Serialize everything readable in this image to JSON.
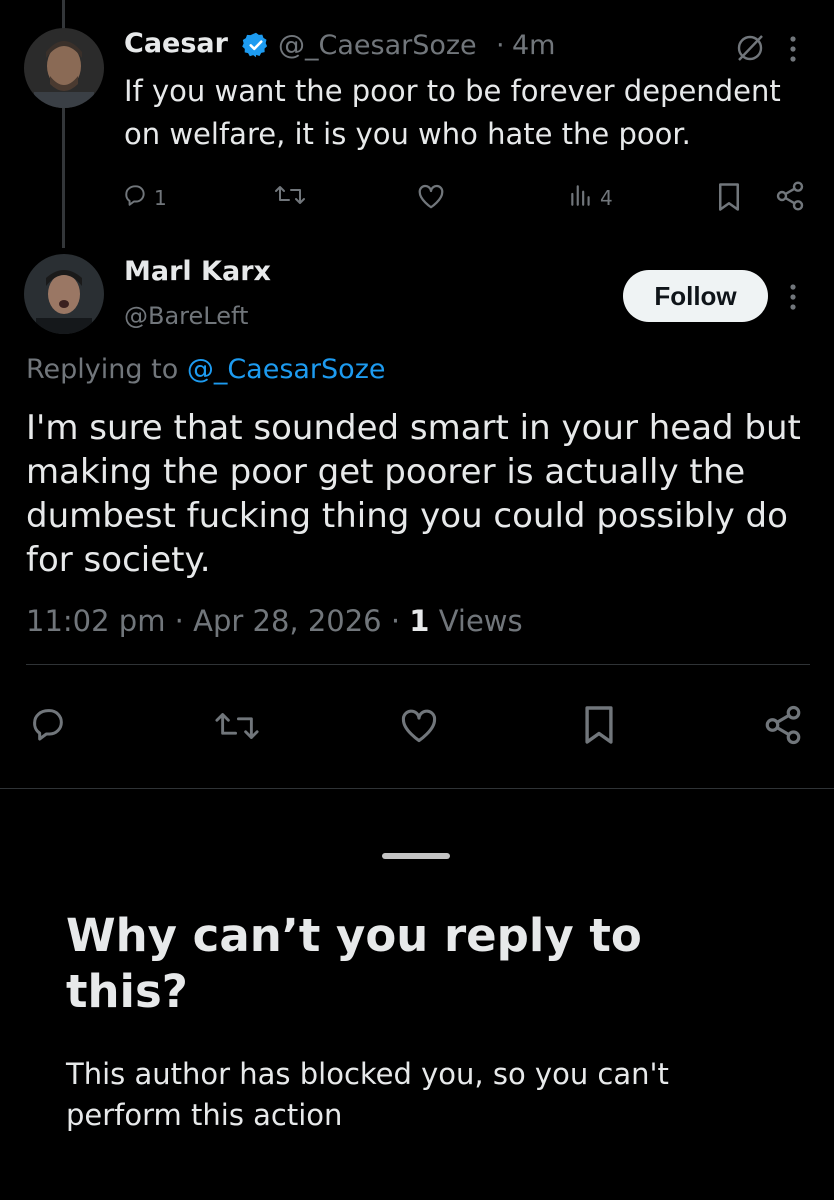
{
  "quoted_tweet": {
    "author_name": "Caesar",
    "handle": "@_CaesarSoze",
    "separator": "·",
    "time": "4m",
    "text": "If you want the poor to be forever dependent on welfare, it is you who hate the poor.",
    "reply_count": "1",
    "view_count": "4",
    "icons": [
      "verified-badge-icon",
      "grok-icon",
      "more-icon",
      "reply-icon",
      "retweet-icon",
      "like-icon",
      "views-icon",
      "bookmark-icon",
      "share-icon"
    ]
  },
  "reply_tweet": {
    "author_name": "Marl Karx",
    "handle": "@BareLeft",
    "follow_label": "Follow",
    "replying_prefix": "Replying to",
    "replying_handle": "@_CaesarSoze",
    "text": "I'm sure that sounded smart in your head but making the poor get poorer is actually the dumbest fucking thing you could possibly do for society.",
    "timestamp": "11:02 pm · Apr 28, 2026 ·",
    "views_count": "1",
    "views_label": "Views"
  },
  "sheet": {
    "title": "Why can’t you reply to this?",
    "body": "This author has blocked you, so you can't perform this action"
  },
  "colors": {
    "background": "#000000",
    "text": "#e7e9ea",
    "secondary": "#71767b",
    "link": "#1d9bf0",
    "verified": "#1d9bf0",
    "follow_bg": "#eff3f4"
  }
}
